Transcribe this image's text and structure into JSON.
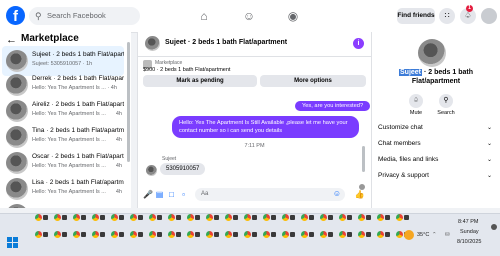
{
  "header": {
    "logo": "f",
    "search_placeholder": "Search Facebook",
    "find_friends_label": "Find friends",
    "notification_count": "1",
    "nav_icons": [
      "home-icon",
      "friends-icon",
      "groups-icon"
    ]
  },
  "sidebar": {
    "title": "Marketplace",
    "conversations": [
      {
        "name": "Sujeet · 2 beds 1 bath Flat/apartment",
        "preview": "Sujeet: 5305910057 · 1h",
        "time": ""
      },
      {
        "name": "Derrek · 2 beds 1 bath Flat/apart...",
        "preview": "Hello: Yes The Apartment Is ... · 4h",
        "time": ""
      },
      {
        "name": "Aireliz · 2 beds 1 bath Flat/apart...",
        "preview": "Hello: Yes The Apartment Is ...",
        "time": "4h"
      },
      {
        "name": "Tina · 2 beds 1 bath Flat/apartm...",
        "preview": "Hello: Yes The Apartment Is ...",
        "time": "4h"
      },
      {
        "name": "Oscar · 2 beds 1 bath Flat/apart...",
        "preview": "Hello: Yes The Apartment Is ...",
        "time": "4h"
      },
      {
        "name": "Lisa · 2 beds 1 bath Flat/apartm...",
        "preview": "Hello: Yes The Apartment Is ...",
        "time": "4h"
      },
      {
        "name": "...",
        "preview": "",
        "time": ""
      }
    ]
  },
  "chat": {
    "title": "Sujeet · 2 beds 1 bath Flat/apartment",
    "listing_label": "Marketplace",
    "listing_price": "$900 · 2 beds 1 bath Flat/apartment",
    "mark_pending_label": "Mark as pending",
    "more_options_label": "More options",
    "outgoing_1": "Yes, are you interested?",
    "outgoing_2": "Hello: Yes The Apartment Is Still Available ,please let me have your contact number so i can send you details",
    "timestamp": "7:11 PM",
    "sender_name": "Sujeet",
    "incoming_1": "5305910057",
    "input_placeholder": "Aa"
  },
  "details": {
    "name_highlighted": "Sujeet",
    "name_rest": " · 2 beds 1 bath Flat/apartment",
    "mute_label": "Mute",
    "search_label": "Search",
    "sections": [
      "Customize chat",
      "Chat members",
      "Media, files and links",
      "Privacy & support"
    ]
  },
  "taskbar": {
    "weather": "35°C",
    "time": "8:47 PM",
    "day": "Sunday",
    "date": "8/10/2025"
  },
  "colors": {
    "brand": "#0866ff",
    "outgoing_bubble": "#7a3cff",
    "badge": "#e41e3f"
  }
}
